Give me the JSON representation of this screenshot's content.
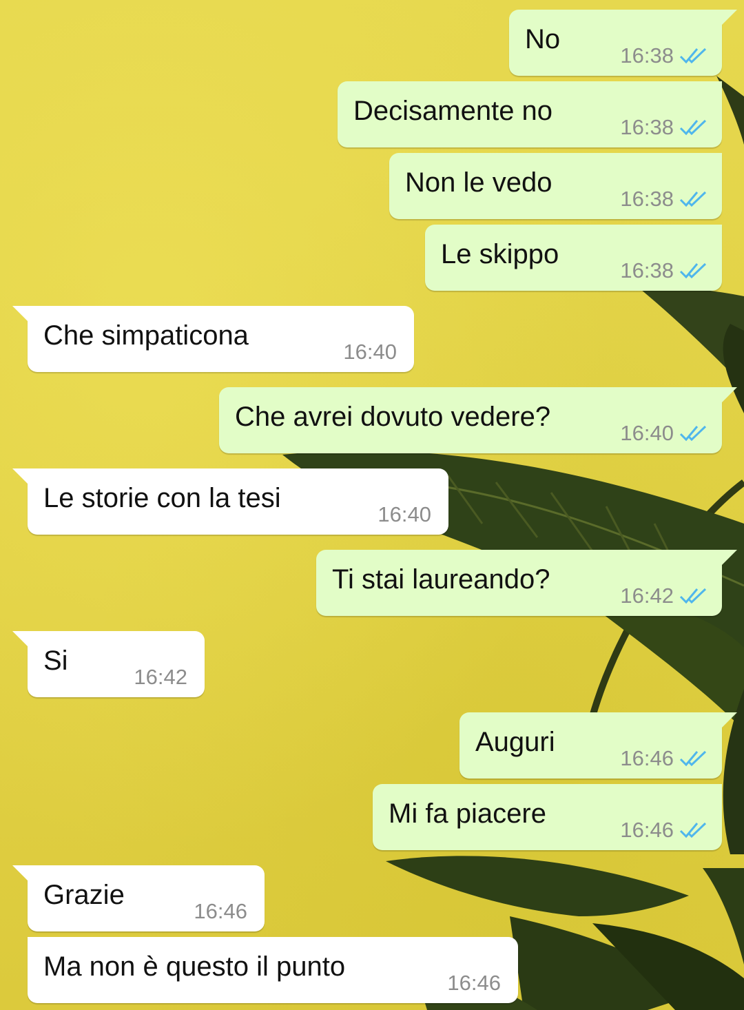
{
  "chat": {
    "messages": [
      {
        "direction": "outgoing",
        "text": "No",
        "time": "16:38",
        "status": "read"
      },
      {
        "direction": "outgoing",
        "text": "Decisamente no",
        "time": "16:38",
        "status": "read"
      },
      {
        "direction": "outgoing",
        "text": "Non le vedo",
        "time": "16:38",
        "status": "read"
      },
      {
        "direction": "outgoing",
        "text": "Le skippo",
        "time": "16:38",
        "status": "read"
      },
      {
        "direction": "incoming",
        "text": "Che simpaticona",
        "time": "16:40"
      },
      {
        "direction": "outgoing",
        "text": "Che avrei dovuto vedere?",
        "time": "16:40",
        "status": "read"
      },
      {
        "direction": "incoming",
        "text": "Le storie con la tesi",
        "time": "16:40"
      },
      {
        "direction": "outgoing",
        "text": "Ti stai laureando?",
        "time": "16:42",
        "status": "read"
      },
      {
        "direction": "incoming",
        "text": "Si",
        "time": "16:42"
      },
      {
        "direction": "outgoing",
        "text": "Auguri",
        "time": "16:46",
        "status": "read"
      },
      {
        "direction": "outgoing",
        "text": "Mi fa piacere",
        "time": "16:46",
        "status": "read"
      },
      {
        "direction": "incoming",
        "text": "Grazie",
        "time": "16:46"
      },
      {
        "direction": "incoming",
        "text": "Ma non è questo il punto",
        "time": "16:46"
      }
    ]
  },
  "theme": {
    "outgoing_bubble": "#e2fdc7",
    "incoming_bubble": "#ffffff",
    "read_tick": "#4fb6ec",
    "wallpaper": "#e4d64a"
  },
  "icons": {
    "read_status": "double-check-icon",
    "wallpaper_art": "banana-leaf"
  }
}
